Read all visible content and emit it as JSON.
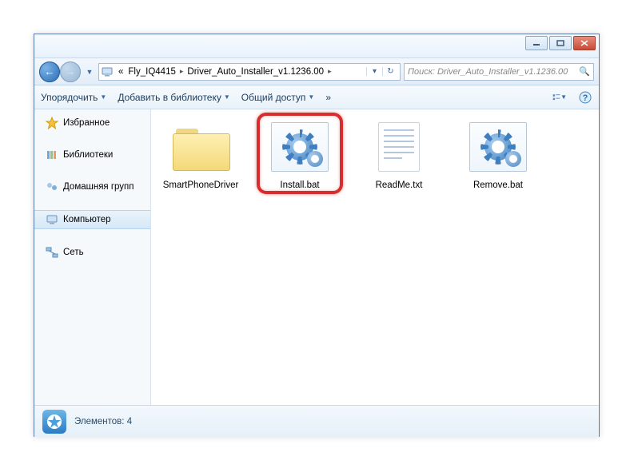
{
  "address": {
    "root_icon": "computer-icon",
    "crumbs": [
      "Fly_IQ4415",
      "Driver_Auto_Installer_v1.1236.00"
    ]
  },
  "search": {
    "placeholder": "Поиск: Driver_Auto_Installer_v1.1236.00"
  },
  "toolbar": {
    "organize": "Упорядочить",
    "add_to_library": "Добавить в библиотеку",
    "share": "Общий доступ",
    "more": "»"
  },
  "sidebar": {
    "favorites": "Избранное",
    "libraries": "Библиотеки",
    "homegroup": "Домашняя групп",
    "computer": "Компьютер",
    "network": "Сеть"
  },
  "items": [
    {
      "name": "SmartPhoneDriver",
      "type": "folder",
      "highlighted": false
    },
    {
      "name": "Install.bat",
      "type": "bat",
      "highlighted": true
    },
    {
      "name": "ReadMe.txt",
      "type": "txt",
      "highlighted": false
    },
    {
      "name": "Remove.bat",
      "type": "bat",
      "highlighted": false
    }
  ],
  "status": {
    "label": "Элементов:",
    "count": "4"
  }
}
